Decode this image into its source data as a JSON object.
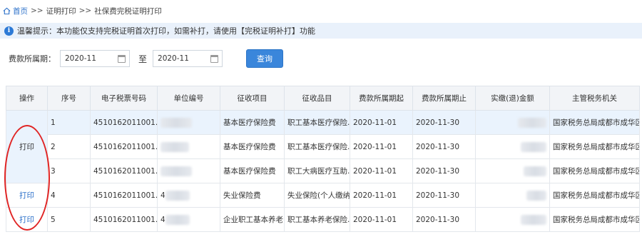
{
  "breadcrumb": {
    "home": "首页",
    "sep": ">>",
    "items": [
      "证明打印",
      "社保费完税证明打印"
    ]
  },
  "notice": {
    "icon": "info-icon",
    "text": "温馨提示：本功能仅支持完税证明首次打印，如需补打，请使用【完税证明补打】功能"
  },
  "filter": {
    "label": "费款所属期：",
    "start_value": "2020-11",
    "to": "至",
    "end_value": "2020-11",
    "query_label": "查询"
  },
  "table": {
    "headers": [
      "操作",
      "序号",
      "电子税票号码",
      "单位编号",
      "征收项目",
      "征收品目",
      "费款所属期起",
      "费款所属期止",
      "实缴(退)金额",
      "主管税务机关"
    ],
    "merged_op": "打印",
    "rows": [
      {
        "seq": "1",
        "ticket": "4510162011001...",
        "unit": "",
        "item": "基本医疗保险费",
        "sub": "职工基本医疗保险...",
        "start": "2020-11-01",
        "end": "2020-11-30",
        "authority": "国家税务总局成都市成华区..."
      },
      {
        "seq": "2",
        "ticket": "4510162011001...",
        "unit": "",
        "item": "基本医疗保险费",
        "sub": "职工基本医疗保险...",
        "start": "2020-11-01",
        "end": "2020-11-30",
        "authority": "国家税务总局成都市成华区..."
      },
      {
        "seq": "3",
        "ticket": "4510162011001...",
        "unit": "",
        "item": "基本医疗保险费",
        "sub": "职工大病医疗互助...",
        "start": "2020-11-01",
        "end": "2020-11-30",
        "authority": "国家税务总局成都市成华区..."
      },
      {
        "seq": "4",
        "op": "打印",
        "ticket": "4510162011001...",
        "unit": "4",
        "item": "失业保险费",
        "sub": "失业保险(个人缴纳)",
        "start": "2020-11-01",
        "end": "2020-11-30",
        "authority": "国家税务总局成都市成华区..."
      },
      {
        "seq": "5",
        "op": "打印",
        "ticket": "4510162011001...",
        "unit": "4",
        "item": "企业职工基本养老...",
        "sub": "职工基本养老保险...",
        "start": "2020-11-01",
        "end": "2020-11-30",
        "authority": "国家税务总局成都市成华区..."
      }
    ]
  },
  "colors": {
    "accent": "#3a86db",
    "link": "#2a6fc9",
    "highlight_row": "#eaf3fd",
    "notice_bg": "#e9f1fb",
    "annotation": "#e02424"
  }
}
